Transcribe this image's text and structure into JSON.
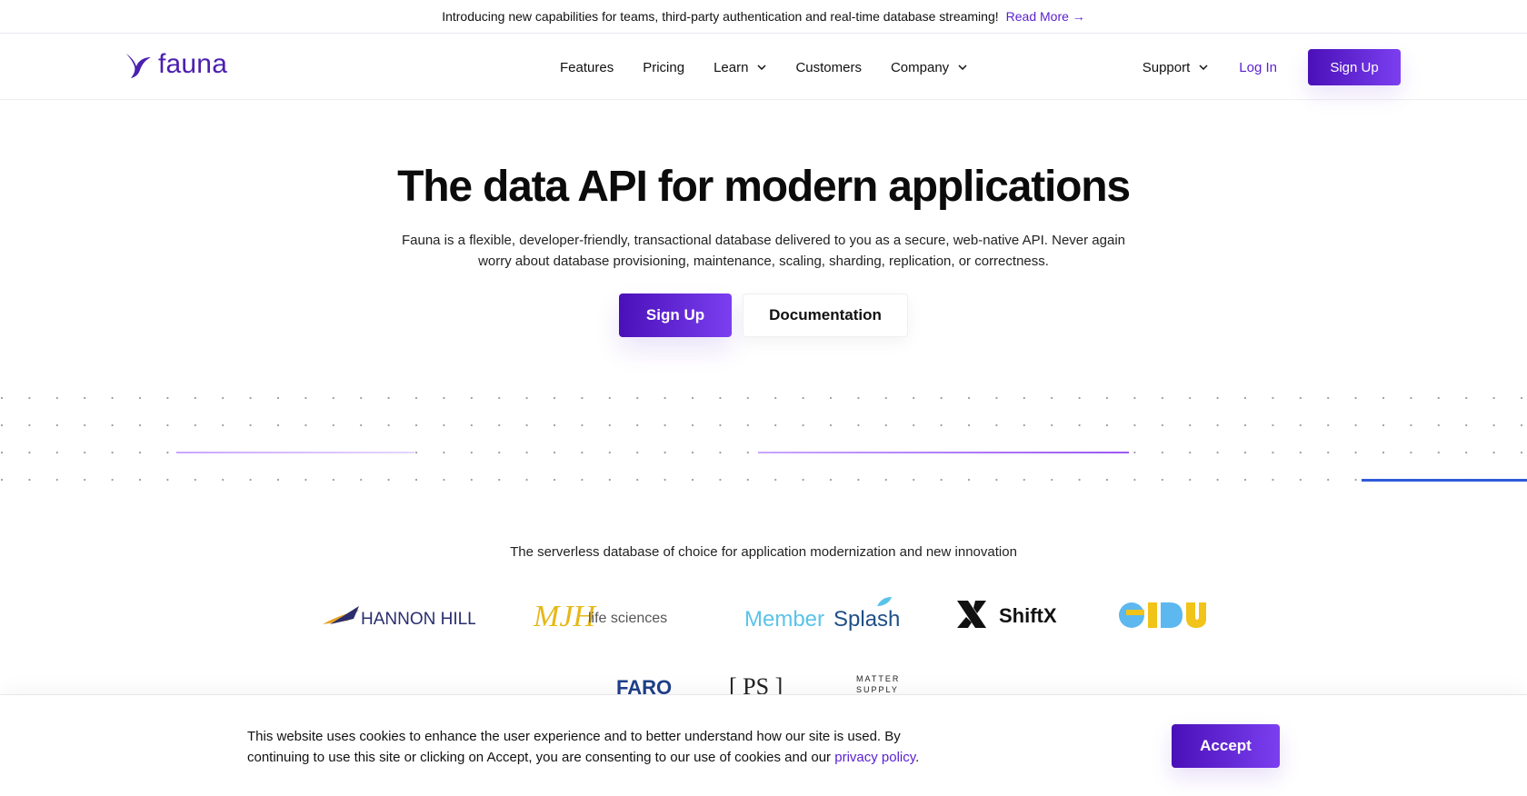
{
  "announcement": {
    "text": "Introducing new capabilities for teams, third-party authentication and real-time database streaming!",
    "link": "Read More →"
  },
  "brand": {
    "name": "fauna",
    "color": "#4b1fb0",
    "accent": "#5a1fd0"
  },
  "nav": {
    "items": [
      {
        "label": "Features",
        "dropdown": false
      },
      {
        "label": "Pricing",
        "dropdown": false
      },
      {
        "label": "Learn",
        "dropdown": true
      },
      {
        "label": "Customers",
        "dropdown": false
      },
      {
        "label": "Company",
        "dropdown": true
      }
    ],
    "support": "Support",
    "login": "Log In",
    "signup": "Sign Up"
  },
  "hero": {
    "title_pre": "The",
    "title_bold": "data API",
    "title_post": "for modern applications",
    "subtitle": "Fauna is a flexible, developer-friendly, transactional database delivered to you as a secure, web-native API. Never again worry about database provisioning, maintenance, scaling, sharding, replication, or correctness.",
    "primary_cta": "Sign Up",
    "secondary_cta": "Documentation"
  },
  "customers": {
    "tagline": "The serverless database of choice for application modernization and new innovation",
    "logos": [
      {
        "name": "HANNON HILL"
      },
      {
        "name": "MJH life sciences"
      },
      {
        "name": "Member Splash"
      },
      {
        "name": "ShiftX"
      },
      {
        "name": "eidu"
      },
      {
        "name": "FAROS"
      },
      {
        "name": "[ PS ]"
      },
      {
        "name": "MATTER SUPPLY"
      }
    ]
  },
  "cookie": {
    "text": "This website uses cookies to enhance the user experience and to better understand how our site is used. By continuing to use this site or clicking on Accept, you are consenting to our use of cookies and our",
    "link": "privacy policy",
    "end": ".",
    "accept": "Accept"
  }
}
